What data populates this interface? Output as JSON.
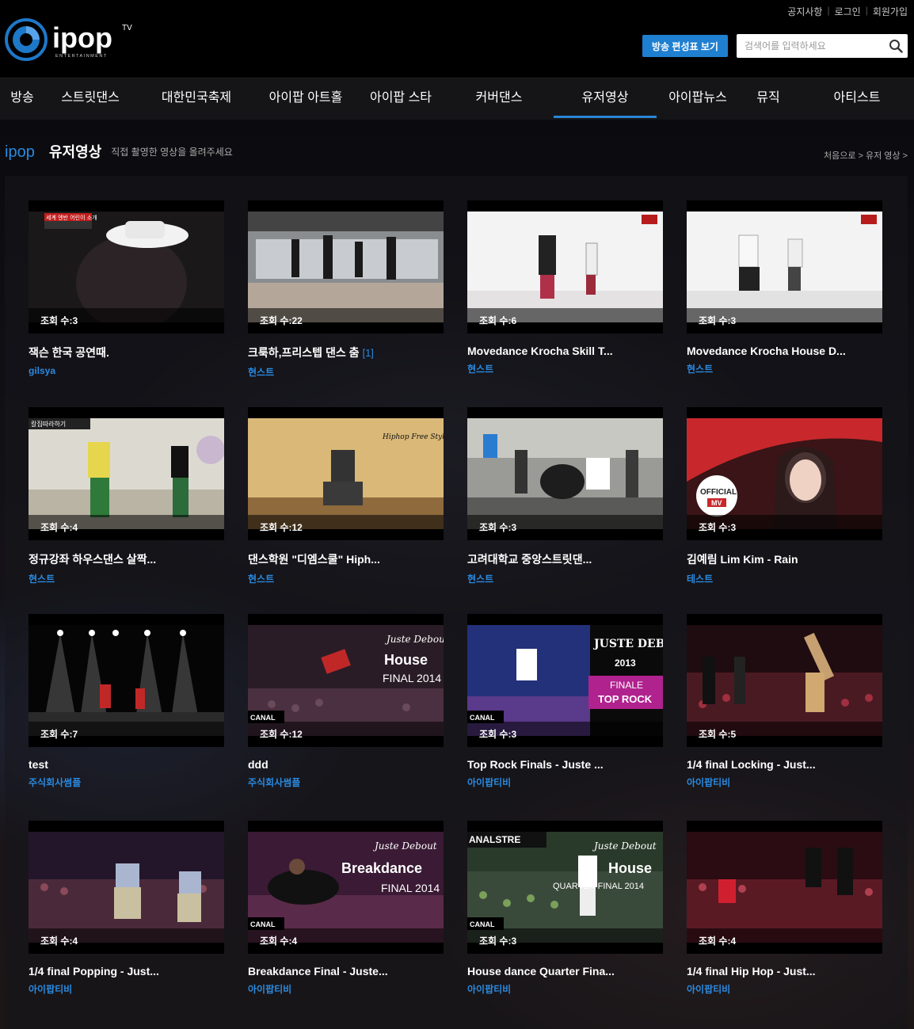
{
  "util_links": [
    "공지사항",
    "로그인",
    "회원가입"
  ],
  "logo": {
    "text": "ipop",
    "tv": "TV",
    "sub": "ENTERTAINMENT"
  },
  "schedule_button": "방송 편성표 보기",
  "search": {
    "placeholder": "검색어를 입력하세요"
  },
  "nav": [
    "방송",
    "스트릿댄스",
    "대한민국축제",
    "아이팝 아트홀",
    "아이팝 스타",
    "커버댄스",
    "유저영상",
    "아이팝뉴스",
    "뮤직",
    "아티스트"
  ],
  "nav_active": "유저영상",
  "section": {
    "brand": "ipop",
    "title": "유저영상",
    "desc": "직접 촬영한 영상을 올려주세요"
  },
  "breadcrumb": "처음으로 > 유저 영상 >",
  "colors": {
    "accent": "#2a86d6",
    "button": "#1f7fd0",
    "author": "#2a8ae0"
  },
  "videos": [
    {
      "views": "조회 수:3",
      "title": "잭슨 한국 공연때.",
      "count": "",
      "author": "gilsya"
    },
    {
      "views": "조회 수:22",
      "title": "크룩하,프리스텝 댄스 춤",
      "count": "[1]",
      "author": "현스트"
    },
    {
      "views": "조회 수:6",
      "title": "Movedance Krocha Skill T...",
      "count": "",
      "author": "현스트"
    },
    {
      "views": "조회 수:3",
      "title": "Movedance Krocha House D...",
      "count": "",
      "author": "현스트"
    },
    {
      "views": "조회 수:4",
      "title": "정규강좌 하우스댄스 살짝...",
      "count": "",
      "author": "현스트"
    },
    {
      "views": "조회 수:12",
      "title": "댄스학원 \"디엠스쿨\" Hiph...",
      "count": "",
      "author": "현스트"
    },
    {
      "views": "조회 수:3",
      "title": "고려대학교 중앙스트릿댄...",
      "count": "",
      "author": "현스트"
    },
    {
      "views": "조회 수:3",
      "title": "김예림 Lim Kim - Rain",
      "count": "",
      "author": "테스트"
    },
    {
      "views": "조회 수:7",
      "title": "test",
      "count": "",
      "author": "주식회사썸플"
    },
    {
      "views": "조회 수:12",
      "title": "ddd",
      "count": "",
      "author": "주식회사썸플"
    },
    {
      "views": "조회 수:3",
      "title": "Top Rock Finals - Juste ...",
      "count": "",
      "author": "아이팝티비"
    },
    {
      "views": "조회 수:5",
      "title": "1/4 final Locking - Just...",
      "count": "",
      "author": "아이팝티비"
    },
    {
      "views": "조회 수:4",
      "title": "1/4 final Popping - Just...",
      "count": "",
      "author": "아이팝티비"
    },
    {
      "views": "조회 수:4",
      "title": "Breakdance Final - Juste...",
      "count": "",
      "author": "아이팝티비"
    },
    {
      "views": "조회 수:3",
      "title": "House dance Quarter Fina...",
      "count": "",
      "author": "아이팝티비"
    },
    {
      "views": "조회 수:4",
      "title": "1/4 final Hip Hop - Just...",
      "count": "",
      "author": "아이팝티비"
    }
  ],
  "thumb_overlays": {
    "v2_tag": "세계 엔반 어린이 소개",
    "v5_tag": "칼집따라하기",
    "v6_tag": "Hiphop Free Style",
    "v8_badge": [
      "OFFICIAL",
      "MV"
    ],
    "v10_brand": "Juste Debout",
    "v10_main": "House",
    "v10_sub": "FINAL 2014",
    "v11_brand": "JUSTE DEBOUT",
    "v11_year": "2013",
    "v11_label1": "FINALE",
    "v11_label2": "TOP ROCK",
    "v14_main": "Breakdance",
    "v14_sub": "FINAL 2014",
    "v15_main": "House",
    "v15_sub": "QUARTER FINAL 2014",
    "canal": "CANAL"
  }
}
